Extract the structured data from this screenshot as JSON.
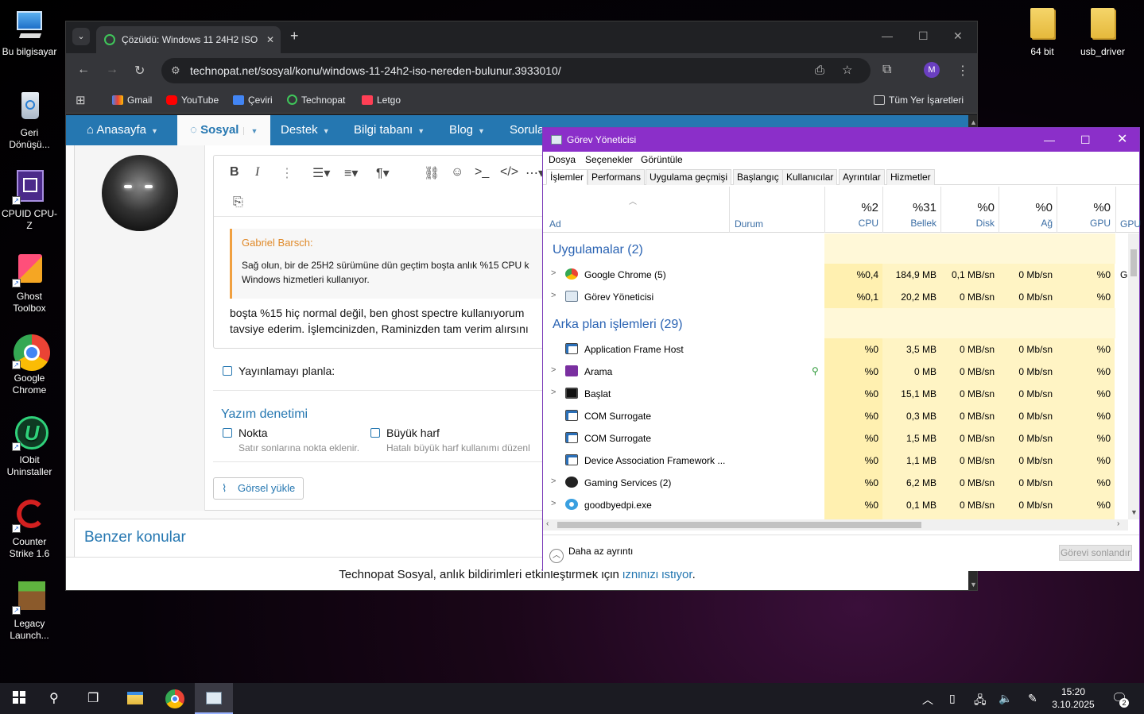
{
  "desktop": {
    "icons": [
      {
        "label": "Bu bilgisayar"
      },
      {
        "label": "Geri Dönüşü..."
      },
      {
        "label": "CPUID CPU-Z"
      },
      {
        "label": "Ghost Toolbox"
      },
      {
        "label": "Google Chrome"
      },
      {
        "label": "IObit Uninstaller"
      },
      {
        "label": "Counter Strike 1.6"
      },
      {
        "label": "Legacy Launch..."
      }
    ],
    "folders": [
      {
        "label": "64 bit"
      },
      {
        "label": "usb_driver"
      }
    ]
  },
  "browser": {
    "tab_title": "Çözüldü: Windows 11 24H2 ISO",
    "tab_close": "✕",
    "new_tab": "+",
    "url": "technopat.net/sosyal/konu/windows-11-24h2-iso-nereden-bulunur.3933010/",
    "profile_initial": "M",
    "bookmarks": [
      {
        "label": "Gmail"
      },
      {
        "label": "YouTube"
      },
      {
        "label": "Çeviri"
      },
      {
        "label": "Technopat"
      },
      {
        "label": "Letgo"
      }
    ],
    "all_bookmarks": "Tüm Yer İşaretleri"
  },
  "site": {
    "nav": [
      {
        "label": "Anasayfa"
      },
      {
        "label": "Sosyal"
      },
      {
        "label": "Destek"
      },
      {
        "label": "Bilgi tabanı"
      },
      {
        "label": "Blog"
      },
      {
        "label": "Sorula"
      }
    ],
    "quote_author": "Gabriel Barsch:",
    "quote_line1": "Sağ olun, bir de 25H2 sürümüne dün geçtim boşta anlık %15 CPU k",
    "quote_line2": "Windows hizmetleri kullanıyor.",
    "reply_line1": "boşta %15 hiç normal değil, ben ghost spectre kullanıyorum",
    "reply_line2": "tavsiye ederim. İşlemcinizden, Raminizden tam verim alırsını",
    "schedule_label": "Yayınlamayı planla:",
    "spellcheck_title": "Yazım denetimi",
    "opt1_label": "Nokta",
    "opt1_hint": "Satır sonlarına nokta eklenir.",
    "opt2_label": "Büyük harf",
    "opt2_hint": "Hatalı büyük harf kullanımı düzenl",
    "upload_label": "Görsel yükle",
    "similar_title": "Benzer konular",
    "notif_text": "Technopat Sosyal, anlık bildirimleri etkinleştirmek için ",
    "notif_link": "izninizi istiyor",
    "notif_end": "."
  },
  "taskmanager": {
    "title": "Görev Yöneticisi",
    "menu": [
      "Dosya",
      "Seçenekler",
      "Görüntüle"
    ],
    "tabs": [
      "İşlemler",
      "Performans",
      "Uygulama geçmişi",
      "Başlangıç",
      "Kullanıcılar",
      "Ayrıntılar",
      "Hizmetler"
    ],
    "col_name": "Ad",
    "col_status": "Durum",
    "cols": [
      {
        "pct": "%2",
        "name": "CPU"
      },
      {
        "pct": "%31",
        "name": "Bellek"
      },
      {
        "pct": "%0",
        "name": "Disk"
      },
      {
        "pct": "%0",
        "name": "Ağ"
      },
      {
        "pct": "%0",
        "name": "GPU"
      }
    ],
    "col_extra": "GPU",
    "group_apps": "Uygulamalar (2)",
    "group_bg": "Arka plan işlemleri (29)",
    "apps": [
      {
        "name": "Google Chrome (5)",
        "cpu": "%0,4",
        "mem": "184,9 MB",
        "disk": "0,1 MB/sn",
        "net": "0 Mb/sn",
        "gpu": "%0",
        "extra": "G"
      },
      {
        "name": "Görev Yöneticisi",
        "cpu": "%0,1",
        "mem": "20,2 MB",
        "disk": "0 MB/sn",
        "net": "0 Mb/sn",
        "gpu": "%0",
        "extra": ""
      }
    ],
    "bg": [
      {
        "name": "Application Frame Host",
        "cpu": "%0",
        "mem": "3,5 MB",
        "disk": "0 MB/sn",
        "net": "0 Mb/sn",
        "gpu": "%0"
      },
      {
        "name": "Arama",
        "cpu": "%0",
        "mem": "0 MB",
        "disk": "0 MB/sn",
        "net": "0 Mb/sn",
        "gpu": "%0"
      },
      {
        "name": "Başlat",
        "cpu": "%0",
        "mem": "15,1 MB",
        "disk": "0 MB/sn",
        "net": "0 Mb/sn",
        "gpu": "%0"
      },
      {
        "name": "COM Surrogate",
        "cpu": "%0",
        "mem": "0,3 MB",
        "disk": "0 MB/sn",
        "net": "0 Mb/sn",
        "gpu": "%0"
      },
      {
        "name": "COM Surrogate",
        "cpu": "%0",
        "mem": "1,5 MB",
        "disk": "0 MB/sn",
        "net": "0 Mb/sn",
        "gpu": "%0"
      },
      {
        "name": "Device Association Framework ...",
        "cpu": "%0",
        "mem": "1,1 MB",
        "disk": "0 MB/sn",
        "net": "0 Mb/sn",
        "gpu": "%0"
      },
      {
        "name": "Gaming Services (2)",
        "cpu": "%0",
        "mem": "6,2 MB",
        "disk": "0 MB/sn",
        "net": "0 Mb/sn",
        "gpu": "%0"
      },
      {
        "name": "goodbyedpi.exe",
        "cpu": "%0",
        "mem": "0,1 MB",
        "disk": "0 MB/sn",
        "net": "0 Mb/sn",
        "gpu": "%0"
      }
    ],
    "less_details": "Daha az ayrıntı",
    "end_task": "Görevi sonlandır"
  },
  "taskbar": {
    "time": "15:20",
    "date": "3.10.2025",
    "notif_count": "2"
  }
}
